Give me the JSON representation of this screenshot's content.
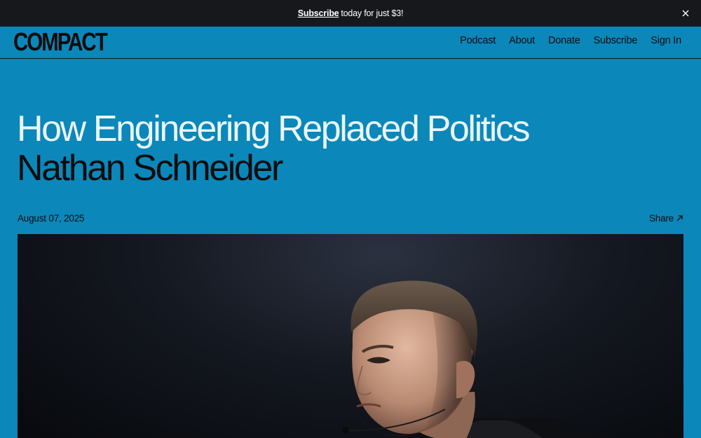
{
  "promo": {
    "link_label": "Subscribe",
    "text": "today for just $3!",
    "close_icon": "close-icon"
  },
  "header": {
    "logo": "COMPACT",
    "nav": [
      "Podcast",
      "About",
      "Donate",
      "Subscribe",
      "Sign In"
    ]
  },
  "article": {
    "title": "How Engineering Replaced Politics",
    "author": "Nathan Schneider",
    "date": "August 07, 2025",
    "share_label": "Share",
    "share_icon": "arrow-up-right-icon",
    "hero_image": "portrait of a man speaking into a headset microphone against a dark background"
  },
  "colors": {
    "page_background": "#0b87ba",
    "promo_background": "#17181c",
    "title_text": "#eaf6fb",
    "body_text": "#0c0c0c"
  }
}
